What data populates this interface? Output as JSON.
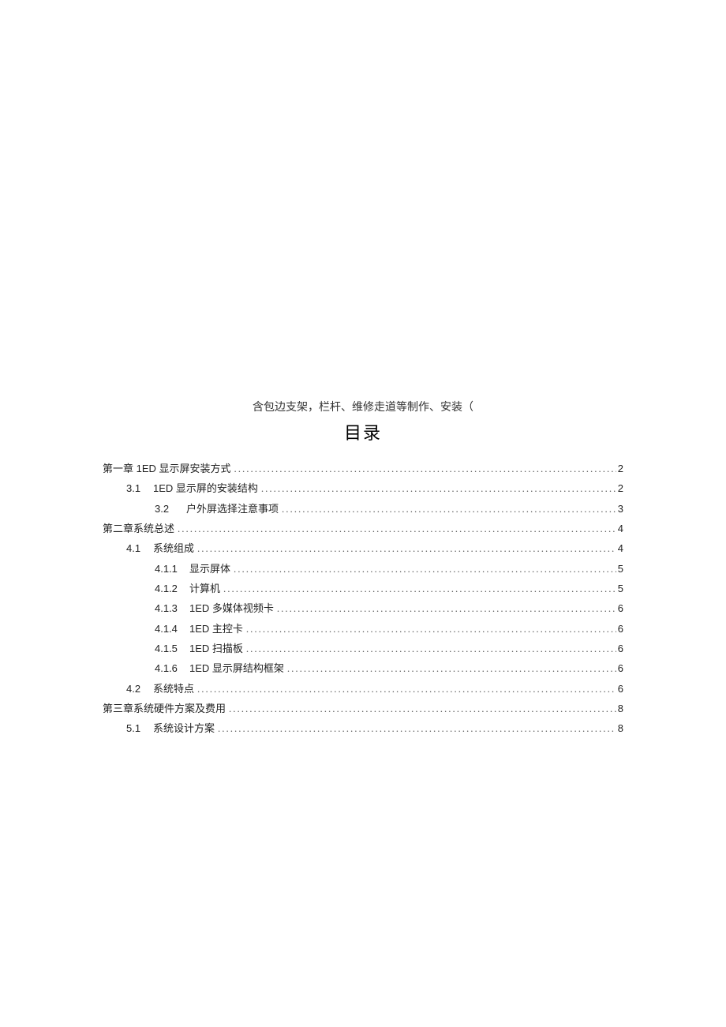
{
  "subtitle": "含包边支架，栏杆、维修走道等制作、安装（",
  "toc_title": "目录",
  "toc": [
    {
      "level": 0,
      "num": "",
      "text": "第一章 1ED 显示屏安装方式",
      "page": "2"
    },
    {
      "level": 1,
      "num": "3.1",
      "text": "1ED 显示屏的安装结构 ",
      "page": "2"
    },
    {
      "level": 2,
      "num": "3.2",
      "text": "户外屏选择注意事项",
      "page": "3"
    },
    {
      "level": 0,
      "num": "",
      "text": "第二章系统总述 ",
      "page": "4"
    },
    {
      "level": 1,
      "num": "4.1",
      "text": "系统组成 ",
      "page": "4"
    },
    {
      "level": 3,
      "num": "4.1.1",
      "text": "显示屏体",
      "page": "5"
    },
    {
      "level": 3,
      "num": "4.1.2",
      "text": "计算机",
      "page": "5"
    },
    {
      "level": 3,
      "num": "4.1.3",
      "text": "1ED 多媒体视频卡",
      "page": "6"
    },
    {
      "level": 3,
      "num": "4.1.4",
      "text": "1ED 主控卡",
      "page": "6"
    },
    {
      "level": 3,
      "num": "4.1.5",
      "text": "1ED 扫描板",
      "page": "6"
    },
    {
      "level": 3,
      "num": "4.1.6",
      "text": "1ED 显示屏结构框架",
      "page": "6"
    },
    {
      "level": 1,
      "num": "4.2",
      "text": "系统特点 ",
      "page": "6"
    },
    {
      "level": 0,
      "num": "",
      "text": "第三章系统硬件方案及费用 ",
      "page": "8"
    },
    {
      "level": 1,
      "num": "5.1",
      "text": "系统设计方案 ",
      "page": "8"
    }
  ]
}
